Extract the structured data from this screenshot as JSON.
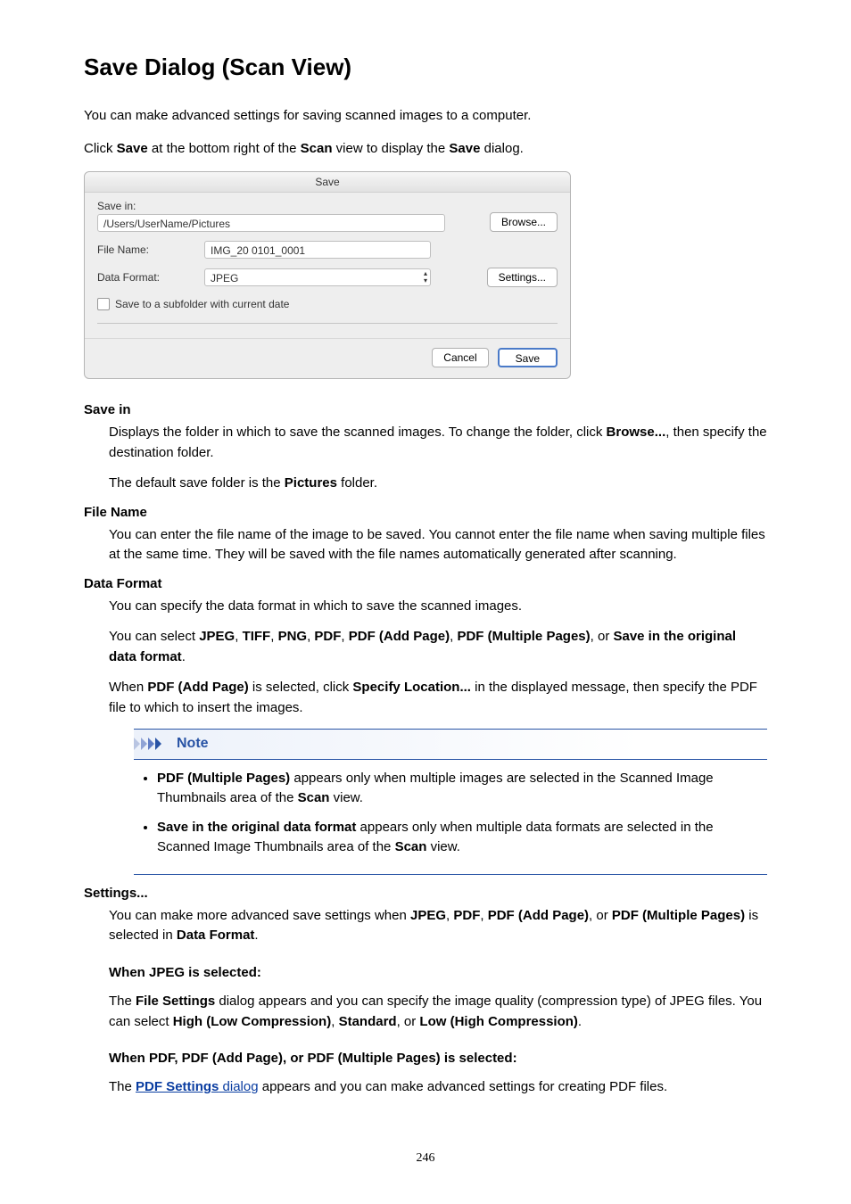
{
  "title": "Save Dialog (Scan View)",
  "intro1": "You can make advanced settings for saving scanned images to a computer.",
  "intro2_pre": "Click ",
  "intro2_b1": "Save",
  "intro2_mid": " at the bottom right of the ",
  "intro2_b2": "Scan",
  "intro2_mid2": " view to display the ",
  "intro2_b3": "Save",
  "intro2_post": " dialog.",
  "dialog": {
    "title": "Save",
    "save_in_label": "Save in:",
    "save_in_path": "/Users/UserName/Pictures",
    "browse_btn": "Browse...",
    "file_name_label": "File Name:",
    "file_name_value": "IMG_20   0101_0001",
    "data_format_label": "Data Format:",
    "data_format_value": "JPEG",
    "settings_btn": "Settings...",
    "subfolder_label": "Save to a subfolder with current date",
    "cancel_btn": "Cancel",
    "save_btn": "Save"
  },
  "defs": {
    "save_in": {
      "title": "Save in",
      "p1_pre": "Displays the folder in which to save the scanned images. To change the folder, click ",
      "p1_b": "Browse...",
      "p1_post": ", then specify the destination folder.",
      "p2_pre": "The default save folder is the ",
      "p2_b": "Pictures",
      "p2_post": " folder."
    },
    "file_name": {
      "title": "File Name",
      "p1": "You can enter the file name of the image to be saved. You cannot enter the file name when saving multiple files at the same time. They will be saved with the file names automatically generated after scanning."
    },
    "data_format": {
      "title": "Data Format",
      "p1": "You can specify the data format in which to save the scanned images.",
      "p2_pre": "You can select ",
      "fmt": [
        "JPEG",
        "TIFF",
        "PNG",
        "PDF",
        "PDF (Add Page)",
        "PDF (Multiple Pages)"
      ],
      "or": ", or ",
      "last_b": "Save in the original data format",
      "p2_post": ".",
      "p3_pre": "When ",
      "p3_b1": "PDF (Add Page)",
      "p3_mid": " is selected, click ",
      "p3_b2": "Specify Location...",
      "p3_post": " in the displayed message, then specify the PDF file to which to insert the images."
    },
    "note": {
      "label": "Note",
      "li1_b": "PDF (Multiple Pages)",
      "li1_mid": " appears only when multiple images are selected in the Scanned Image Thumbnails area of the ",
      "li1_b2": "Scan",
      "li1_post": " view.",
      "li2_b": "Save in the original data format",
      "li2_mid": " appears only when multiple data formats are selected in the Scanned Image Thumbnails area of the ",
      "li2_b2": "Scan",
      "li2_post": " view."
    },
    "settings": {
      "title": "Settings...",
      "p1_pre": "You can make more advanced save settings when ",
      "p1_fmts": [
        "JPEG",
        "PDF",
        "PDF (Add Page)"
      ],
      "p1_or": ", or ",
      "p1_last": "PDF (Multiple Pages)",
      "p1_mid": " is selected in ",
      "p1_b": "Data Format",
      "p1_post": ".",
      "sub_jpeg": "When JPEG is selected:",
      "jpeg_pre": "The ",
      "jpeg_b1": "File Settings",
      "jpeg_mid": " dialog appears and you can specify the image quality (compression type) of JPEG files. You can select ",
      "jpeg_opts": [
        "High (Low Compression)",
        "Standard"
      ],
      "jpeg_or": ", or ",
      "jpeg_last": "Low (High Compression)",
      "jpeg_post": ".",
      "sub_pdf": "When PDF, PDF (Add Page), or PDF (Multiple Pages) is selected:",
      "pdf_pre": "The ",
      "pdf_link_b": "PDF Settings",
      "pdf_link_rest": " dialog",
      "pdf_post": " appears and you can make advanced settings for creating PDF files."
    }
  },
  "page_number": "246"
}
